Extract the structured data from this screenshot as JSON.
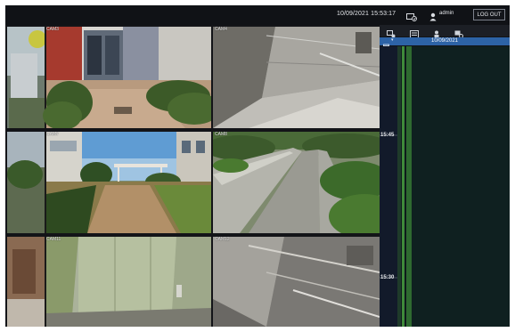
{
  "header": {
    "datetime": "10/09/2021 15:53:17",
    "user": "admin",
    "logout_label": "LOG OUT"
  },
  "icons": {
    "status": "status-icon",
    "user": "user-icon",
    "toolbar": [
      "camera-playback-icon",
      "list-icon",
      "person-icon",
      "camera-settings-icon"
    ],
    "calendar": "calendar-icon",
    "chevron": "chevron-down-icon"
  },
  "cameras": [
    {
      "label": "CAM3"
    },
    {
      "label": "CAM4"
    },
    {
      "label": "CAM7"
    },
    {
      "label": "CAM8"
    },
    {
      "label": "CAM11"
    },
    {
      "label": "CAM12"
    }
  ],
  "panel": {
    "date": "10/09/2021",
    "chevron": "▾",
    "time_labels": [
      "15:45",
      "15:30"
    ]
  },
  "colors": {
    "accent": "#2d63a6",
    "timeline_green": "#3f8a3a",
    "background": "#0d0f13"
  }
}
